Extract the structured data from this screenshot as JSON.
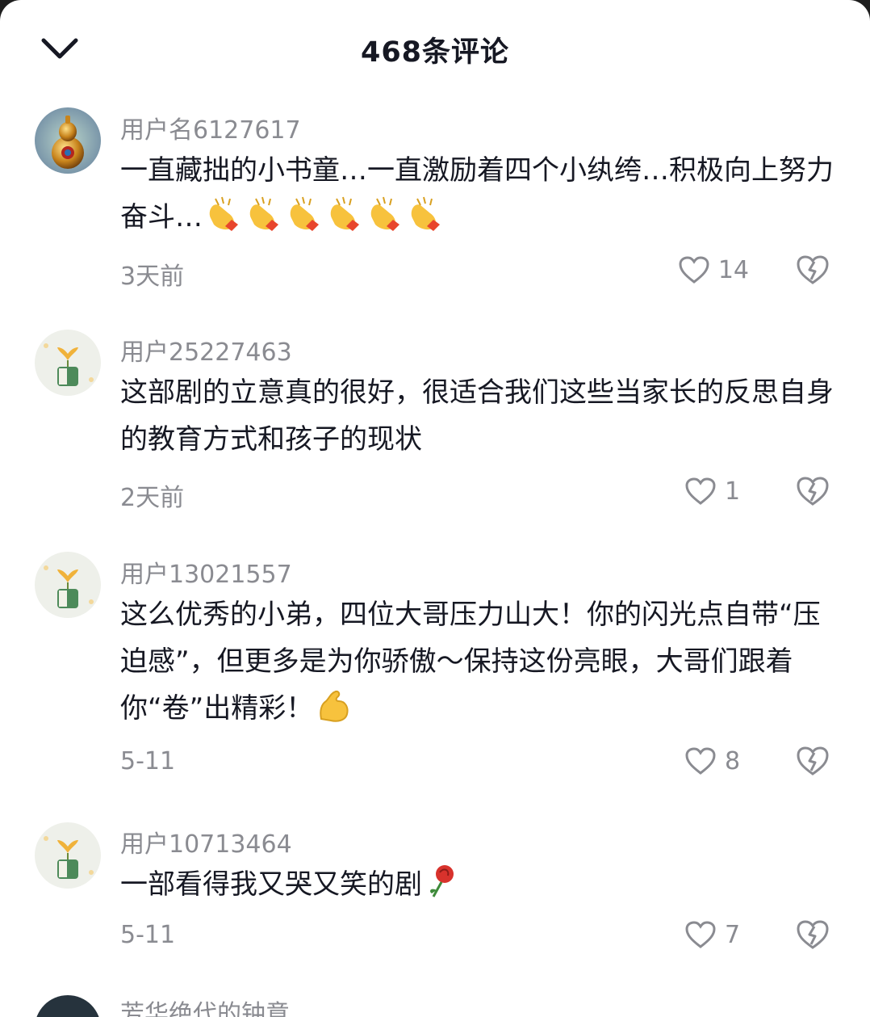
{
  "header": {
    "title": "468条评论",
    "collapse_icon": "chevron-down-icon"
  },
  "comments": [
    {
      "username": "用户名6127617",
      "text": "一直藏拙的小书童…一直激励着四个小纨绔…积极向上努力奋斗…",
      "emoji": "clapping-hands ×6",
      "time": "3天前",
      "likes": "14"
    },
    {
      "username": "用户25227463",
      "text": "这部剧的立意真的很好，很适合我们这些当家长的反思自身的教育方式和孩子的现状",
      "time": "2天前",
      "likes": "1"
    },
    {
      "username": "用户13021557",
      "text": "这么优秀的小弟，四位大哥压力山大！你的闪光点自带“压迫感”，但更多是为你骄傲～保持这份亮眼，大哥们跟着你“卷”出精彩！",
      "emoji": "flexed-biceps",
      "time": "5-11",
      "likes": "8"
    },
    {
      "username": "用户10713464",
      "text": "一部看得我又哭又笑的剧",
      "emoji": "rose",
      "time": "5-11",
      "likes": "7"
    }
  ],
  "next_comment": {
    "username_partial": "芳华绝代的钟意"
  },
  "colors": {
    "text_primary": "#161823",
    "text_secondary": "#8a8b91",
    "background": "#ffffff"
  }
}
